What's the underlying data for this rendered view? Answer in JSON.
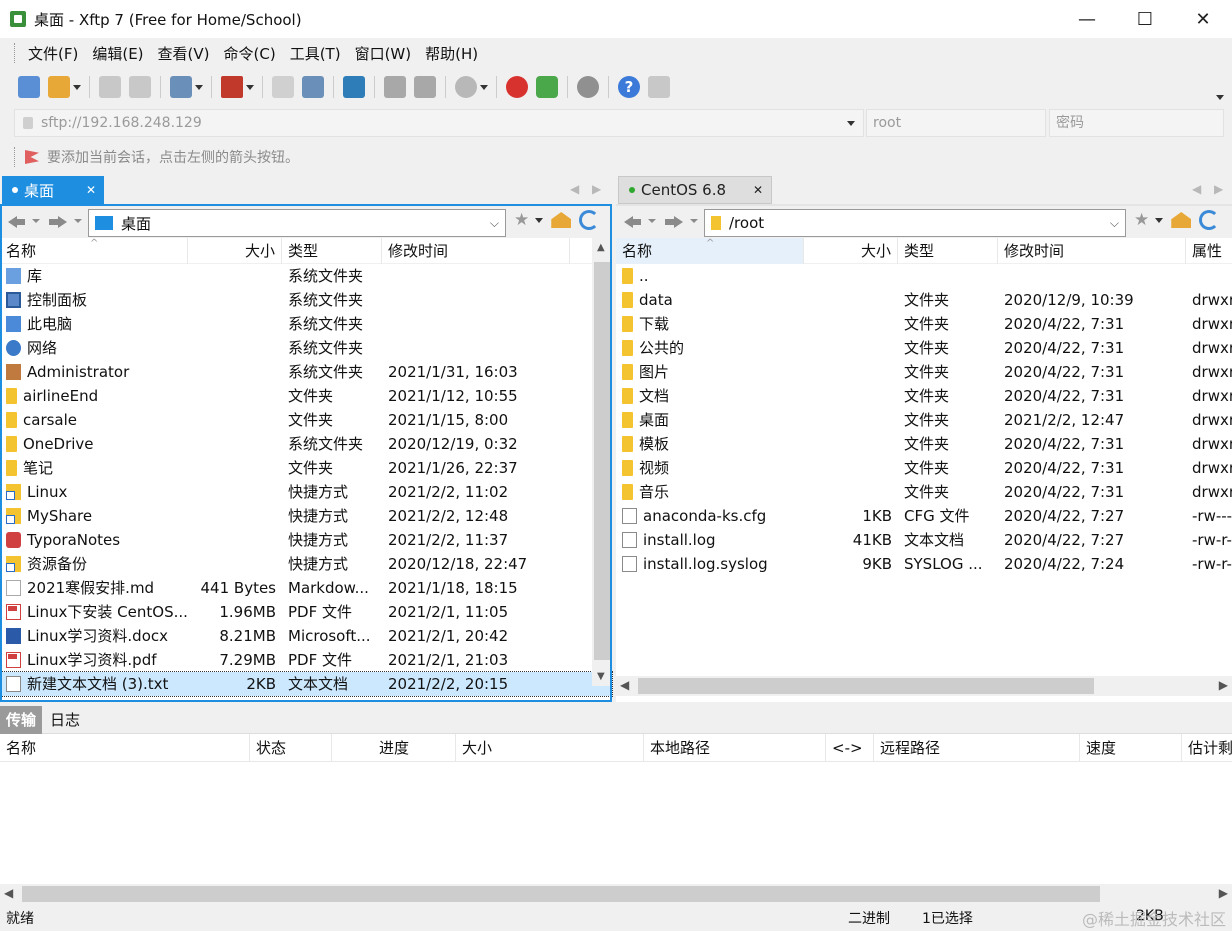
{
  "window": {
    "title": "桌面 - Xftp 7 (Free for Home/School)",
    "minimize": "—",
    "maximize": "☐",
    "close": "✕"
  },
  "menu": [
    "文件(F)",
    "编辑(E)",
    "查看(V)",
    "命令(C)",
    "工具(T)",
    "窗口(W)",
    "帮助(H)"
  ],
  "toolbar": {
    "help_glyph": "?"
  },
  "address": {
    "host_placeholder": "sftp://192.168.248.129",
    "user_placeholder": "root",
    "password_placeholder": "密码"
  },
  "hint": "要添加当前会话，点击左侧的箭头按钮。",
  "left_panel": {
    "tab_label": "桌面",
    "path": "桌面",
    "columns": [
      "名称",
      "大小",
      "类型",
      "修改时间"
    ],
    "rows": [
      {
        "name": "库",
        "size": "",
        "type": "系统文件夹",
        "modified": "",
        "icon": "library"
      },
      {
        "name": "控制面板",
        "size": "",
        "type": "系统文件夹",
        "modified": "",
        "icon": "control"
      },
      {
        "name": "此电脑",
        "size": "",
        "type": "系统文件夹",
        "modified": "",
        "icon": "pc"
      },
      {
        "name": "网络",
        "size": "",
        "type": "系统文件夹",
        "modified": "",
        "icon": "network"
      },
      {
        "name": "Administrator",
        "size": "",
        "type": "系统文件夹",
        "modified": "2021/1/31, 16:03",
        "icon": "user"
      },
      {
        "name": "airlineEnd",
        "size": "",
        "type": "文件夹",
        "modified": "2021/1/12, 10:55",
        "icon": "folder-plain"
      },
      {
        "name": "carsale",
        "size": "",
        "type": "文件夹",
        "modified": "2021/1/15, 8:00",
        "icon": "folder-plain"
      },
      {
        "name": "OneDrive",
        "size": "",
        "type": "系统文件夹",
        "modified": "2020/12/19, 0:32",
        "icon": "folder-plain"
      },
      {
        "name": "笔记",
        "size": "",
        "type": "文件夹",
        "modified": "2021/1/26, 22:37",
        "icon": "folder-plain"
      },
      {
        "name": "Linux",
        "size": "",
        "type": "快捷方式",
        "modified": "2021/2/2, 11:02",
        "icon": "shortcut"
      },
      {
        "name": "MyShare",
        "size": "",
        "type": "快捷方式",
        "modified": "2021/2/2, 12:48",
        "icon": "shortcut"
      },
      {
        "name": "TyporaNotes",
        "size": "",
        "type": "快捷方式",
        "modified": "2021/2/2, 11:37",
        "icon": "typora"
      },
      {
        "name": "资源备份",
        "size": "",
        "type": "快捷方式",
        "modified": "2020/12/18, 22:47",
        "icon": "shortcut"
      },
      {
        "name": "2021寒假安排.md",
        "size": "441 Bytes",
        "type": "Markdow...",
        "modified": "2021/1/18, 18:15",
        "icon": "md"
      },
      {
        "name": "Linux下安装 CentOS...",
        "size": "1.96MB",
        "type": "PDF 文件",
        "modified": "2021/2/1, 11:05",
        "icon": "pdf"
      },
      {
        "name": "Linux学习资料.docx",
        "size": "8.21MB",
        "type": "Microsoft...",
        "modified": "2021/2/1, 20:42",
        "icon": "docx"
      },
      {
        "name": "Linux学习资料.pdf",
        "size": "7.29MB",
        "type": "PDF 文件",
        "modified": "2021/2/1, 21:03",
        "icon": "pdf"
      },
      {
        "name": "新建文本文档 (3).txt",
        "size": "2KB",
        "type": "文本文档",
        "modified": "2021/2/2, 20:15",
        "icon": "txt",
        "selected": true
      }
    ]
  },
  "right_panel": {
    "tab_label": "CentOS 6.8",
    "path": "/root",
    "columns": [
      "名称",
      "大小",
      "类型",
      "修改时间",
      "属性"
    ],
    "rows": [
      {
        "name": "..",
        "size": "",
        "type": "",
        "modified": "",
        "attr": "",
        "icon": "folder-plain"
      },
      {
        "name": "data",
        "size": "",
        "type": "文件夹",
        "modified": "2020/12/9, 10:39",
        "attr": "drwxr",
        "icon": "folder-plain"
      },
      {
        "name": "下载",
        "size": "",
        "type": "文件夹",
        "modified": "2020/4/22, 7:31",
        "attr": "drwxr",
        "icon": "folder-plain"
      },
      {
        "name": "公共的",
        "size": "",
        "type": "文件夹",
        "modified": "2020/4/22, 7:31",
        "attr": "drwxr",
        "icon": "folder-plain"
      },
      {
        "name": "图片",
        "size": "",
        "type": "文件夹",
        "modified": "2020/4/22, 7:31",
        "attr": "drwxr",
        "icon": "folder-plain"
      },
      {
        "name": "文档",
        "size": "",
        "type": "文件夹",
        "modified": "2020/4/22, 7:31",
        "attr": "drwxr",
        "icon": "folder-plain"
      },
      {
        "name": "桌面",
        "size": "",
        "type": "文件夹",
        "modified": "2021/2/2, 12:47",
        "attr": "drwxr",
        "icon": "folder-plain"
      },
      {
        "name": "模板",
        "size": "",
        "type": "文件夹",
        "modified": "2020/4/22, 7:31",
        "attr": "drwxr",
        "icon": "folder-plain"
      },
      {
        "name": "视频",
        "size": "",
        "type": "文件夹",
        "modified": "2020/4/22, 7:31",
        "attr": "drwxr",
        "icon": "folder-plain"
      },
      {
        "name": "音乐",
        "size": "",
        "type": "文件夹",
        "modified": "2020/4/22, 7:31",
        "attr": "drwxr",
        "icon": "folder-plain"
      },
      {
        "name": "anaconda-ks.cfg",
        "size": "1KB",
        "type": "CFG 文件",
        "modified": "2020/4/22, 7:27",
        "attr": "-rw---",
        "icon": "file"
      },
      {
        "name": "install.log",
        "size": "41KB",
        "type": "文本文档",
        "modified": "2020/4/22, 7:27",
        "attr": "-rw-r-",
        "icon": "txt"
      },
      {
        "name": "install.log.syslog",
        "size": "9KB",
        "type": "SYSLOG ...",
        "modified": "2020/4/22, 7:24",
        "attr": "-rw-r-",
        "icon": "file"
      }
    ]
  },
  "transfer": {
    "tabs": [
      "传输",
      "日志"
    ],
    "columns": [
      "名称",
      "状态",
      "进度",
      "大小",
      "本地路径",
      "<->",
      "远程路径",
      "速度",
      "估计剩"
    ]
  },
  "status": {
    "ready": "就绪",
    "mode": "二进制",
    "selection": "1已选择",
    "size": "2KB"
  },
  "watermark": "@稀土掘金技术社区"
}
